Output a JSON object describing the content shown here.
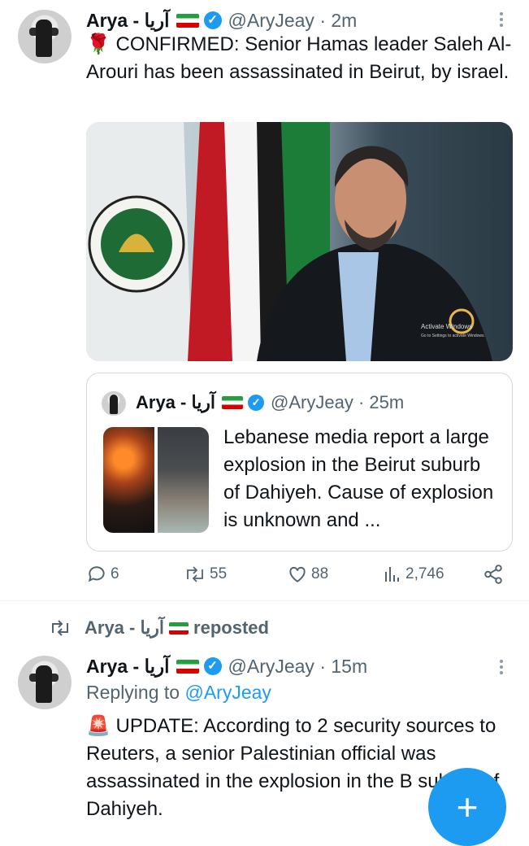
{
  "tweet1": {
    "name": "Arya - آریا",
    "handle": "@AryJeay",
    "time": "2m",
    "text": "🌹 CONFIRMED: Senior Hamas leader Saleh Al-Arouri has been assassinated in Beirut, by israel.",
    "media": {
      "watermark": "Activate Windows",
      "watermark_sub": "Go to Settings to activate Windows."
    }
  },
  "quote": {
    "name": "Arya - آریا",
    "handle": "@AryJeay",
    "time": "25m",
    "text": "Lebanese media report a large explosion in the Beirut suburb of Dahiyeh. Cause of explosion is unknown and ..."
  },
  "actions": {
    "replies": "6",
    "reposts": "55",
    "likes": "88",
    "views": "2,746"
  },
  "repost_banner": {
    "name": "Arya - آریا",
    "label": "reposted"
  },
  "tweet2": {
    "name": "Arya - آریا",
    "handle": "@AryJeay",
    "time": "15m",
    "replying_label": "Replying to",
    "replying_handle": "@AryJeay",
    "text": "🚨 UPDATE: According to 2 security sources to Reuters, a senior Palestinian official was assassinated in the explosion in the B suburb of Dahiyeh."
  },
  "colors": {
    "accent": "#1d9bf0",
    "muted": "#536471",
    "text": "#0f1419"
  },
  "icons": [
    "more-icon",
    "verified-icon",
    "reply-icon",
    "repost-icon",
    "like-icon",
    "views-icon",
    "share-icon",
    "compose-icon"
  ]
}
